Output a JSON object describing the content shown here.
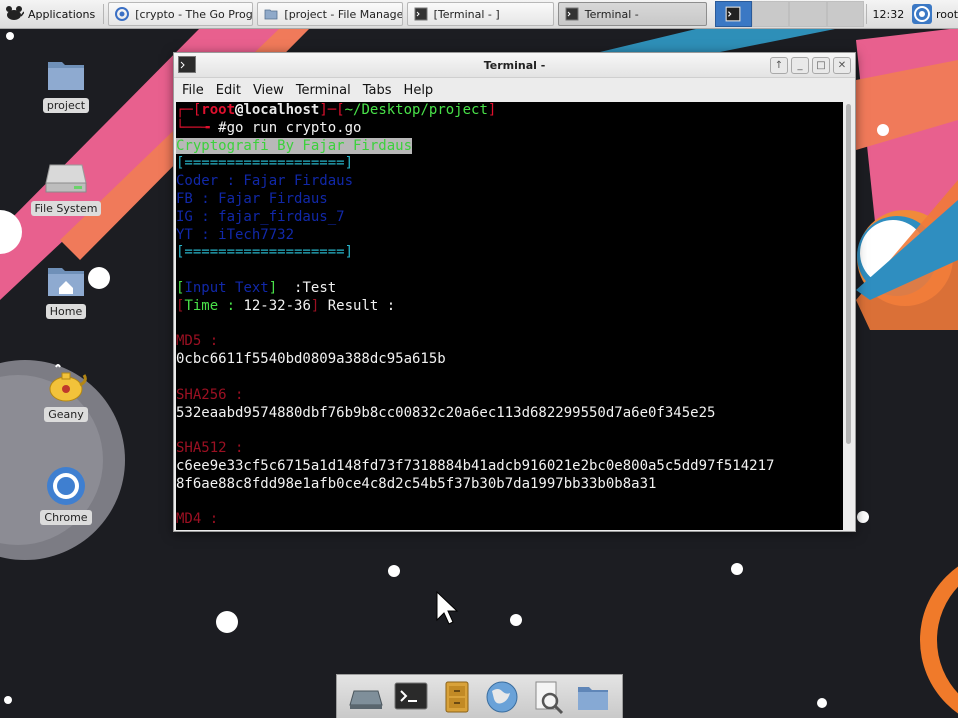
{
  "top_panel": {
    "applications_label": "Applications",
    "tasks": [
      {
        "label": "[crypto - The Go Progra...",
        "icon": "chrome-icon"
      },
      {
        "label": "[project - File Manager]",
        "icon": "folder-icon"
      },
      {
        "label": "[Terminal - ]",
        "icon": "terminal-icon"
      },
      {
        "label": "Terminal -",
        "icon": "terminal-icon"
      }
    ],
    "clock": "12:32",
    "user": "root"
  },
  "desktop_icons": [
    {
      "label": "project",
      "icon": "folder-icon"
    },
    {
      "label": "File System",
      "icon": "drive-icon"
    },
    {
      "label": "Home",
      "icon": "home-folder-icon"
    },
    {
      "label": "Geany",
      "icon": "geany-icon"
    },
    {
      "label": "Chrome",
      "icon": "chrome-icon"
    }
  ],
  "terminal": {
    "title": "Terminal -",
    "menu": [
      "File",
      "Edit",
      "View",
      "Terminal",
      "Tabs",
      "Help"
    ],
    "prompt": {
      "user": "root",
      "at": "@",
      "host": "localhost",
      "path": "~/Desktop/project",
      "command": "#go run crypto.go"
    },
    "banner": "Cryptografi By Fajar Firdaus",
    "divider": "[===================]",
    "info": [
      "Coder : Fajar Firdaus",
      "FB : Fajar Firdaus",
      "IG : fajar_firdaus_7",
      "YT : iTech7732"
    ],
    "input_tag": "Input Text",
    "input_value": ":Test",
    "time_label": "Time : ",
    "time_value": "12-32-36",
    "result_label": " Result :",
    "md5_label": "MD5 :",
    "md5_value": "0cbc6611f5540bd0809a388dc95a615b",
    "sha256_label": "SHA256 :",
    "sha256_value": "532eaabd9574880dbf76b9b8cc00832c20a6ec113d682299550d7a6e0f345e25",
    "sha512_label": "SHA512 :",
    "sha512_line1": "c6ee9e33cf5c6715a1d148fd73f7318884b41adcb916021e2bc0e800a5c5dd97f514217",
    "sha512_line2": "8f6ae88c8fdd98e1afb0ce4c8d2c54b5f37b30b7da1997bb33b0b8a31",
    "md4_label": "MD4 :"
  },
  "dock": [
    "show-desktop-icon",
    "terminal-icon",
    "file-cabinet-icon",
    "web-browser-icon",
    "search-document-icon",
    "folder-icon"
  ]
}
